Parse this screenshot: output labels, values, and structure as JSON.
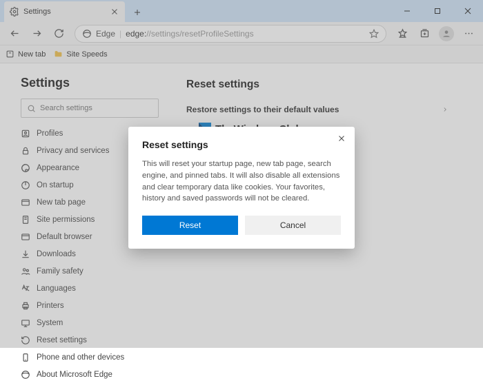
{
  "titlebar": {
    "tab_title": "Settings"
  },
  "toolbar": {
    "edge_label": "Edge",
    "url_prefix": "edge:",
    "url_path": "//settings/resetProfileSettings"
  },
  "bookmarks": {
    "newtab": "New tab",
    "folder1": "Site Speeds"
  },
  "sidebar": {
    "heading": "Settings",
    "search_placeholder": "Search settings",
    "items": [
      {
        "label": "Profiles"
      },
      {
        "label": "Privacy and services"
      },
      {
        "label": "Appearance"
      },
      {
        "label": "On startup"
      },
      {
        "label": "New tab page"
      },
      {
        "label": "Site permissions"
      },
      {
        "label": "Default browser"
      },
      {
        "label": "Downloads"
      },
      {
        "label": "Family safety"
      },
      {
        "label": "Languages"
      },
      {
        "label": "Printers"
      },
      {
        "label": "System"
      },
      {
        "label": "Reset settings"
      },
      {
        "label": "Phone and other devices"
      },
      {
        "label": "About Microsoft Edge"
      }
    ]
  },
  "main": {
    "heading": "Reset settings",
    "row_label": "Restore settings to their default values",
    "brand": "TheWindowsClub"
  },
  "dialog": {
    "title": "Reset settings",
    "body": "This will reset your startup page, new tab page, search engine, and pinned tabs. It will also disable all extensions and clear temporary data like cookies. Your favorites, history and saved passwords will not be cleared.",
    "primary": "Reset",
    "secondary": "Cancel"
  }
}
